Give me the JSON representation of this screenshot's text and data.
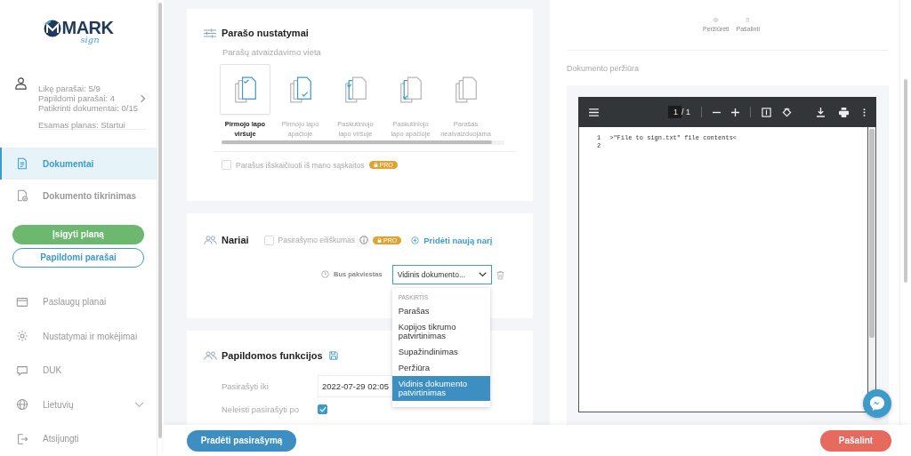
{
  "logo": {
    "text": "MARK",
    "subtitle": "sign"
  },
  "user": {
    "lines": [
      "Likę parašai: 5/9",
      "Papildomi parašai: 4",
      "Patikrinti dokumentai: 0/15"
    ],
    "plan": "Esamas planas: Startui"
  },
  "nav_top": [
    {
      "label": "Dokumentai",
      "selected": true
    },
    {
      "label": "Dokumento tikrinimas",
      "selected": false
    }
  ],
  "sidebar_buttons": [
    {
      "label": "Įsigyti planą",
      "kind": "filled"
    },
    {
      "label": "Papildomi parašai",
      "kind": "outline"
    }
  ],
  "nav_bottom": [
    {
      "label": "Paslaugų planai",
      "selected": false
    },
    {
      "label": "Nustatymai ir mokėjimai",
      "selected": false
    },
    {
      "label": "DUK",
      "selected": false
    },
    {
      "label": "Lietuvių",
      "selected": false,
      "expandable": true
    },
    {
      "label": "Atsijungti",
      "selected": false
    }
  ],
  "signature_settings": {
    "title": "Parašo nustatymai",
    "subtitle": "Parašų atvaizdavimo vieta",
    "options": [
      {
        "label": [
          "Pirmojo lapo",
          "viršuje"
        ],
        "kind": "first-top",
        "selected": true
      },
      {
        "label": [
          "Pirmojo lapo",
          "apačioje"
        ],
        "kind": "first-bottom",
        "selected": false
      },
      {
        "label": [
          "Paskutiniojo",
          "lapo viršuje"
        ],
        "kind": "last-top",
        "selected": false
      },
      {
        "label": [
          "Paskutiniojo",
          "lapo apačioje"
        ],
        "kind": "last-bottom",
        "selected": false
      },
      {
        "label": [
          "Parašas",
          "neatvaizduojama"
        ],
        "kind": "none",
        "selected": false
      }
    ],
    "checkbox": {
      "label": "Parašus išskaičiuoti iš mano sąskaitos",
      "checked": false,
      "badge": "PRO"
    }
  },
  "members": {
    "title": "Nariai",
    "ordering": {
      "label": "Pasirašymo eiliškumas",
      "checked": false,
      "badge": "PRO"
    },
    "add_link": "Pridėti naują narį",
    "member": {
      "status": "Bus pakviestas",
      "role": "Vidinis dokumento...",
      "dropdown": {
        "header": "PASKIRTIS",
        "options": [
          {
            "label": "Parašas",
            "selected": false
          },
          {
            "label": "Kopijos tikrumo patvirtinimas",
            "selected": false
          },
          {
            "label": "Supažindinimas",
            "selected": false
          },
          {
            "label": "Peržiūra",
            "selected": false
          },
          {
            "label": "Vidinis dokumento patvirtinimas",
            "selected": true
          }
        ]
      }
    }
  },
  "extra": {
    "title": "Papildomos funkcijos",
    "fields": [
      {
        "label": "Pasirašyti iki",
        "kind": "date",
        "value": "2022-07-29 02:05"
      },
      {
        "label": "Neleisti pasirašyti po",
        "kind": "checkbox",
        "checked": true
      }
    ]
  },
  "footer": {
    "start_button": "Pradėti pasirašymą",
    "remove_button": "Pašalint"
  },
  "preview": {
    "actions": [
      {
        "label": "Peržiūrėti"
      },
      {
        "label": "Pašalinti"
      }
    ],
    "title": "Dokumento peržiūra",
    "viewer": {
      "page": "1",
      "total": "/ 1",
      "lines": [
        {
          "number": "1",
          "text": ">\"File to sign.txt\" file contents<"
        },
        {
          "number": "2"
        }
      ]
    }
  }
}
